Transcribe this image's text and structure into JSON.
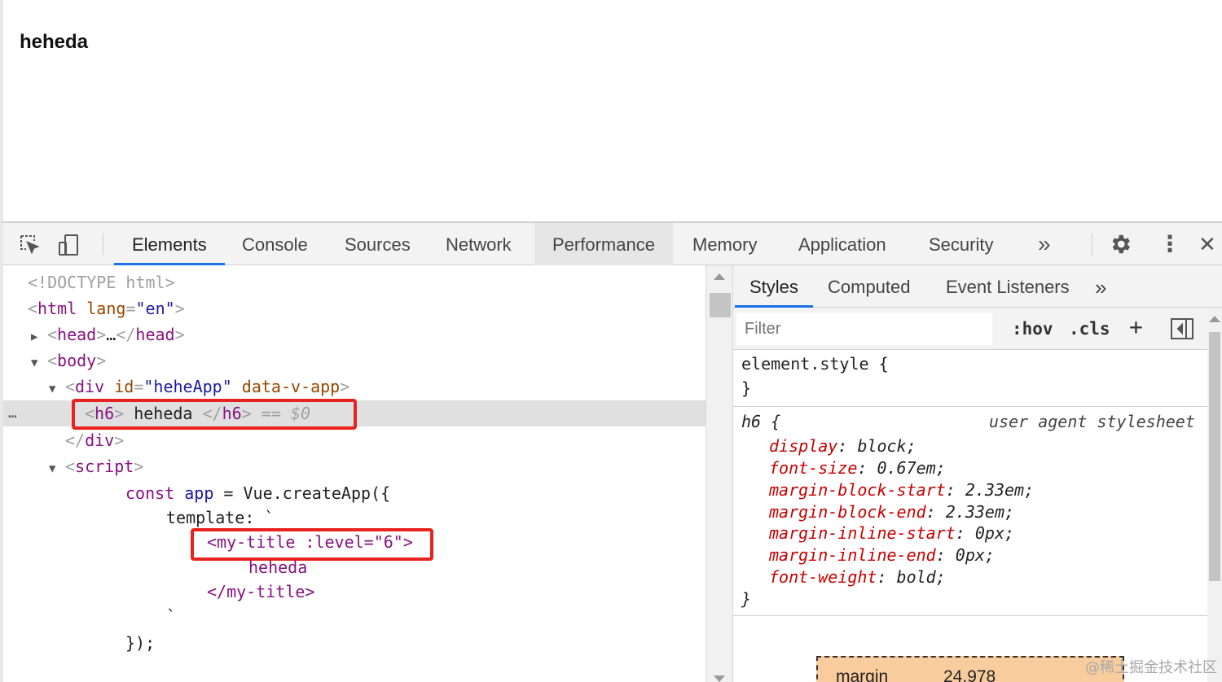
{
  "page": {
    "h6_text": "heheda"
  },
  "toolbar": {
    "tabs": [
      "Elements",
      "Console",
      "Sources",
      "Network",
      "Performance",
      "Memory",
      "Application",
      "Security"
    ],
    "more": "»",
    "kebab": "⋮",
    "close": "✕"
  },
  "elements": {
    "doctype": "<!DOCTYPE html>",
    "html_tag": "html",
    "lang_attr": "lang",
    "lang_val": "\"en\"",
    "head_tag": "head",
    "head_ellipsis": "…",
    "body_tag": "body",
    "div_tag": "div",
    "id_attr": "id",
    "id_val": "\"heheApp\"",
    "data_attr": "data-v-app",
    "h6_tag": "h6",
    "h6_text": " heheda ",
    "selected_marker": "== $0",
    "div_close": "div",
    "script_tag": "script",
    "code_const": "const",
    "code_app": "app",
    "code_eq": " = Vue.createApp({",
    "code_template": "template: `",
    "code_mytitle_open": "<my-title :level=\"6\">",
    "code_heheda": "heheda",
    "code_mytitle_close": "</my-title>",
    "code_backtick": "`",
    "code_close": "});",
    "dots": "…"
  },
  "styles": {
    "tabs": [
      "Styles",
      "Computed",
      "Event Listeners"
    ],
    "more": "»",
    "filter_placeholder": "Filter",
    "hov": ":hov",
    "cls": ".cls",
    "plus": "+",
    "element_style_open": "element.style {",
    "close_brace": "}",
    "h6_selector": "h6 {",
    "source": "user agent stylesheet",
    "rules": [
      {
        "prop": "display",
        "value": "block;"
      },
      {
        "prop": "font-size",
        "value": "0.67em;"
      },
      {
        "prop": "margin-block-start",
        "value": "2.33em;"
      },
      {
        "prop": "margin-block-end",
        "value": "2.33em;"
      },
      {
        "prop": "margin-inline-start",
        "value": "0px;"
      },
      {
        "prop": "margin-inline-end",
        "value": "0px;"
      },
      {
        "prop": "font-weight",
        "value": "bold;"
      }
    ],
    "box_model": {
      "label": "margin",
      "value": "24.978"
    }
  },
  "watermark": "@稀土掘金技术社区"
}
